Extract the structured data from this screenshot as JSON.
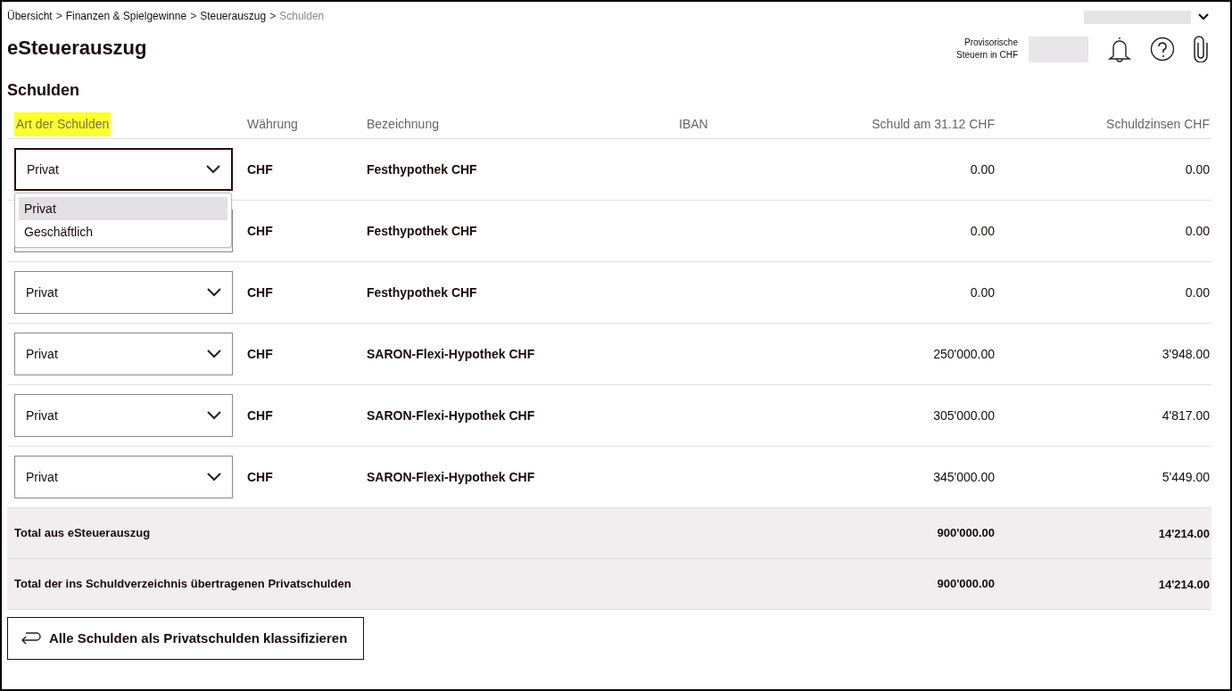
{
  "breadcrumb": [
    {
      "label": "Übersicht",
      "current": false
    },
    {
      "label": "Finanzen & Spielgewinne",
      "current": false
    },
    {
      "label": "Steuerauszug",
      "current": false
    },
    {
      "label": "Schulden",
      "current": true
    }
  ],
  "breadcrumb_separator": ">",
  "page_title": "eSteuerauszug",
  "header": {
    "provisional_label": [
      "Provisorische",
      "Steuern in CHF"
    ]
  },
  "section_title": "Schulden",
  "table": {
    "columns": [
      {
        "label": "Art der Schulden",
        "highlighted": true,
        "kind": "text"
      },
      {
        "label": "Währung",
        "highlighted": false,
        "kind": "text"
      },
      {
        "label": "Bezeichnung",
        "highlighted": false,
        "kind": "text"
      },
      {
        "label": "IBAN",
        "highlighted": false,
        "kind": "text"
      },
      {
        "label": "Schuld am 31.12 CHF",
        "highlighted": false,
        "kind": "amount"
      },
      {
        "label": "Schuldzinsen CHF",
        "highlighted": false,
        "kind": "amount"
      }
    ],
    "rows": [
      {
        "type": "Privat",
        "expanded": true,
        "currency": "CHF",
        "name": "Festhypothek CHF",
        "debt": "0.00",
        "interest": "0.00"
      },
      {
        "expanded": false,
        "currency": "CHF",
        "name": "Festhypothek CHF",
        "debt": "0.00",
        "interest": "0.00"
      },
      {
        "type": "Privat",
        "expanded": false,
        "currency": "CHF",
        "name": "Festhypothek CHF",
        "debt": "0.00",
        "interest": "0.00"
      },
      {
        "type": "Privat",
        "expanded": false,
        "currency": "CHF",
        "name": "SARON-Flexi-Hypothek CHF",
        "debt": "250'000.00",
        "interest": "3'948.00"
      },
      {
        "type": "Privat",
        "expanded": false,
        "currency": "CHF",
        "name": "SARON-Flexi-Hypothek CHF",
        "debt": "305'000.00",
        "interest": "4'817.00"
      },
      {
        "type": "Privat",
        "expanded": false,
        "currency": "CHF",
        "name": "SARON-Flexi-Hypothek CHF",
        "debt": "345'000.00",
        "interest": "5'449.00"
      }
    ],
    "dropdown_options": [
      {
        "label": "Privat",
        "selected": true
      },
      {
        "label": "Geschäftlich",
        "selected": false
      }
    ],
    "totals": [
      {
        "label": "Total aus eSteuerauszug",
        "debt": "900'000.00",
        "interest": "14'214.00"
      },
      {
        "label": "Total der ins Schuldverzeichnis übertragenen Privatschulden",
        "debt": "900'000.00",
        "interest": "14'214.00"
      }
    ]
  },
  "action_button": "Alle Schulden als Privatschulden klassifizieren"
}
